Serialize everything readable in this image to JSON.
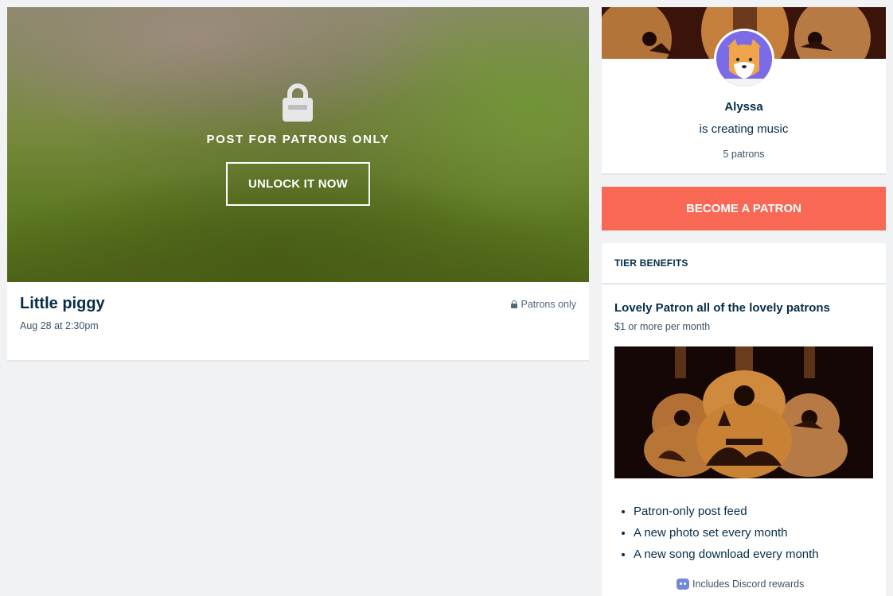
{
  "post": {
    "locked_title": "POST FOR PATRONS ONLY",
    "unlock_label": "UNLOCK IT NOW",
    "title": "Little piggy",
    "date": "Aug 28 at 2:30pm",
    "visibility": "Patrons only",
    "media_icon": "lock-icon"
  },
  "creator": {
    "name": "Alyssa",
    "description": "is creating music",
    "patron_count": "5 patrons",
    "avatar_icon": "fox-avatar"
  },
  "become_patron_label": "BECOME A PATRON",
  "tier": {
    "header": "TIER BENEFITS",
    "title": "Lovely Patron all of the lovely patrons",
    "price": "$1 or more per month",
    "benefits": [
      "Patron-only post feed",
      "A new photo set every month",
      "A new song download every month"
    ],
    "discord": "Includes Discord rewards"
  },
  "colors": {
    "brand_coral": "#f96854",
    "navy_text": "#052d49",
    "avatar_bg": "#7b6be8",
    "discord": "#7289da"
  }
}
